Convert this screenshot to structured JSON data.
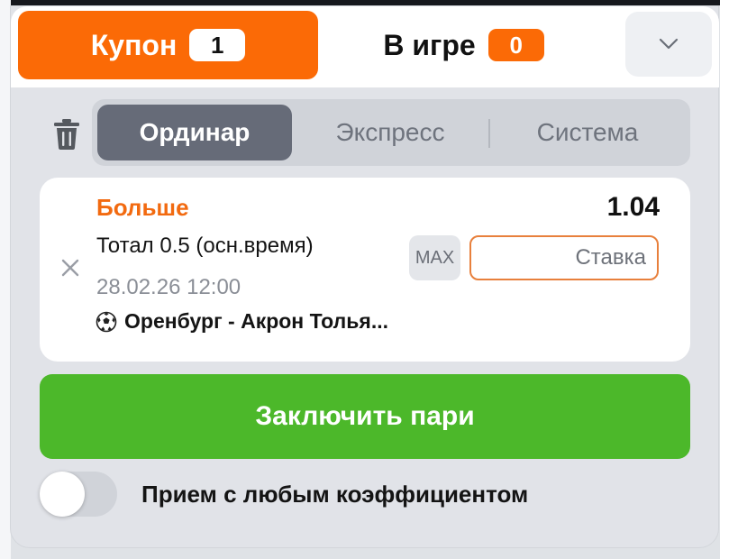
{
  "header": {
    "coupon_label": "Купон",
    "coupon_count": "1",
    "ingame_label": "В игре",
    "ingame_count": "0"
  },
  "bet_types": {
    "single": "Ординар",
    "express": "Экспресс",
    "system": "Система",
    "active": "single"
  },
  "bet_card": {
    "outcome": "Больше",
    "odds": "1.04",
    "market": "Тотал 0.5 (осн.время)",
    "date": "28.02.26 12:00",
    "event": "Оренбург - Акрон Толья...",
    "sport_icon": "soccer-ball-icon",
    "max_label": "MAX",
    "stake_placeholder": "Ставка",
    "stake_value": ""
  },
  "actions": {
    "place_bet_label": "Заключить пари"
  },
  "settings": {
    "accept_any_odds_label": "Прием с любым коэффициентом",
    "accept_any_odds_enabled": false
  },
  "colors": {
    "accent": "#fb6a06",
    "success": "#4cb82a",
    "active_segment": "#666b78"
  }
}
